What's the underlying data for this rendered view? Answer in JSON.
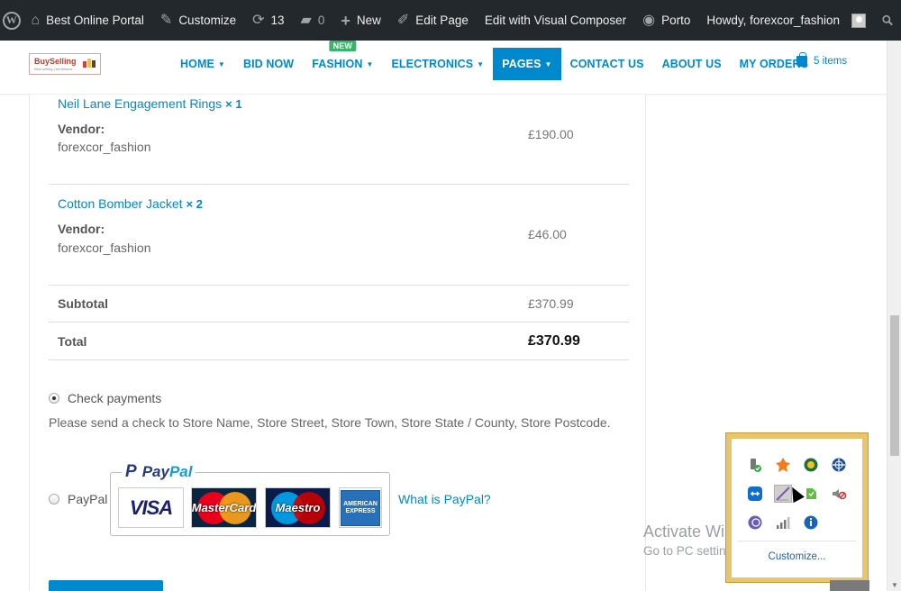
{
  "admin_bar": {
    "site_name": "Best Online Portal",
    "customize": "Customize",
    "updates_count": "13",
    "comments_count": "0",
    "new_label": "New",
    "edit_page": "Edit Page",
    "edit_visual": "Edit with Visual Composer",
    "theme": "Porto",
    "howdy": "Howdy, forexcor_fashion"
  },
  "header": {
    "logo_text": "BuySelling",
    "logo_tagline": "Best selling | we believe",
    "nav": [
      {
        "label": "HOME",
        "dropdown": true
      },
      {
        "label": "BID NOW",
        "dropdown": false
      },
      {
        "label": "FASHION",
        "dropdown": true,
        "badge": "NEW"
      },
      {
        "label": "ELECTRONICS",
        "dropdown": true
      },
      {
        "label": "PAGES",
        "dropdown": true,
        "active": true
      },
      {
        "label": "CONTACT US",
        "dropdown": false
      },
      {
        "label": "ABOUT US",
        "dropdown": false
      },
      {
        "label": "MY ORDERS",
        "dropdown": false
      }
    ],
    "cart_label": "5 items"
  },
  "order": {
    "items": [
      {
        "name": "Neil Lane Engagement Rings",
        "qty": "× 1",
        "vendor_label": "Vendor:",
        "vendor": "forexcor_fashion",
        "price": "£190.00"
      },
      {
        "name": "Cotton Bomber Jacket",
        "qty": "× 2",
        "vendor_label": "Vendor:",
        "vendor": "forexcor_fashion",
        "price": "£46.00"
      }
    ],
    "subtotal_label": "Subtotal",
    "subtotal": "£370.99",
    "total_label": "Total",
    "total": "£370.99"
  },
  "payment": {
    "check_label": "Check payments",
    "check_desc": "Please send a check to Store Name, Store Street, Store Town, Store State / County, Store Postcode.",
    "paypal_label": "PayPal",
    "paypal_logo": "PayPal",
    "cards": [
      "VISA",
      "MasterCard",
      "Maestro",
      "AMERICAN EXPRESS"
    ],
    "what_is_paypal": "What is PayPal?"
  },
  "watermark": {
    "title": "Activate Windows",
    "subtitle": "Go to PC settings to activate Windows."
  },
  "tray": {
    "customize": "Customize..."
  },
  "colors": {
    "accent": "#0088cc",
    "admin_bar": "#23282d",
    "new_badge": "#3ab36b",
    "tray_border": "#e8c56c"
  }
}
